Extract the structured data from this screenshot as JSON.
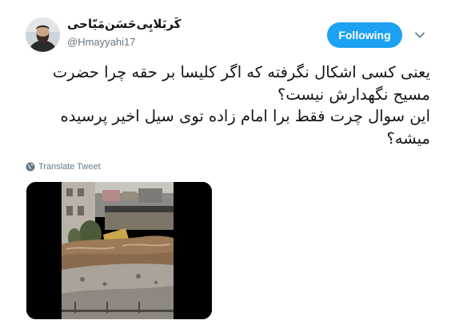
{
  "tweet": {
    "author": {
      "display_name": "کَربَلایِی‌حَسَن‌مَیّاحی",
      "handle": "@Hmayyahi17"
    },
    "follow_button_label": "Following",
    "text_lines": [
      "یعنی کسی اشکال نگرفته که اگر کلیسا بر حقه چرا حضرت",
      "مسیح نگهدارش نیست؟",
      "این سوال چرت فقط برا امام زاده توی سیل اخیر پرسیده",
      "میشه؟"
    ],
    "translate_label": "Translate Tweet",
    "icons": {
      "menu": "chevron-down-icon",
      "translate": "globe-icon"
    },
    "colors": {
      "accent": "#1da1f2",
      "text": "#14171a",
      "secondary": "#657786"
    }
  }
}
